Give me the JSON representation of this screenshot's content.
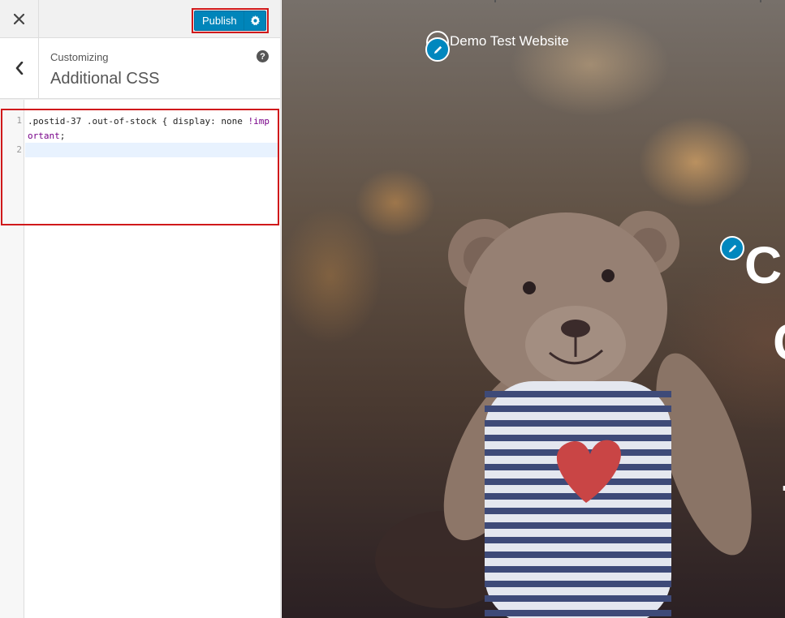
{
  "header": {
    "close_icon": "close-icon",
    "publish_label": "Publish",
    "settings_icon": "gear-icon"
  },
  "section": {
    "back_icon": "chevron-left-icon",
    "customizing_label": "Customizing",
    "title": "Additional CSS",
    "help_icon": "help-icon",
    "help_glyph": "?"
  },
  "editor": {
    "line_numbers": [
      "1",
      "2"
    ],
    "code_line1_part1": ".postid-37 .out-of-stock { ",
    "code_line1_prop": "display:",
    "code_line1_part2": " none ",
    "code_line1_important": "!important",
    "code_line1_end": ";"
  },
  "preview": {
    "site_title": "Demo Test Website",
    "hero_fragments": [
      "Cl",
      "C",
      "."
    ],
    "edit_icon": "pencil-icon"
  },
  "colors": {
    "accent": "#0085ba",
    "highlight_outline": "#d0191b"
  }
}
